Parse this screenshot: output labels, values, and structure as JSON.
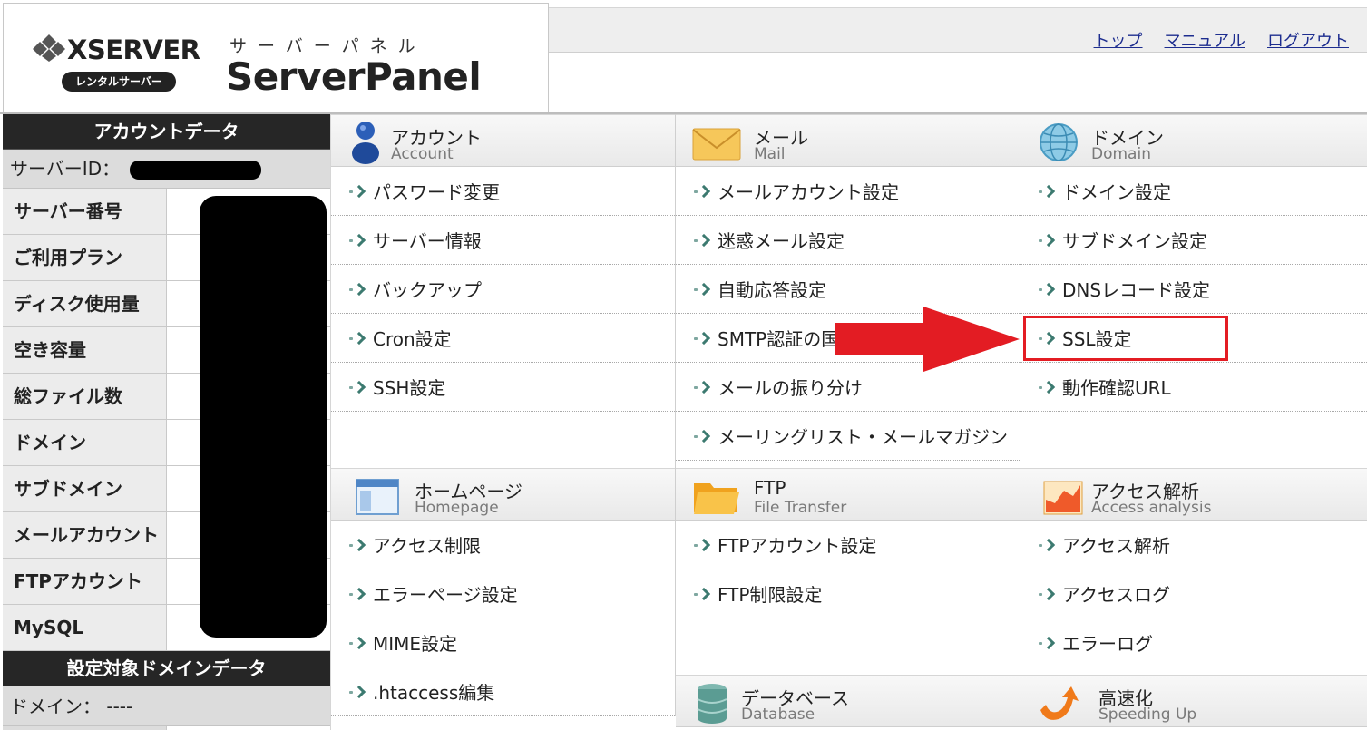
{
  "brand": {
    "xserver": "XSERVER",
    "rental": "レンタルサーバー",
    "panel_sub": "サーバーパネル",
    "panel_main": "ServerPanel"
  },
  "toplinks": [
    "トップ",
    "マニュアル",
    "ログアウト"
  ],
  "account_panel": {
    "title": "アカウントデータ",
    "server_id_label": "サーバーID：",
    "rows": [
      "サーバー番号",
      "ご利用プラン",
      "ディスク使用量",
      "空き容量",
      "総ファイル数",
      "ドメイン",
      "サブドメイン",
      "メールアカウント",
      "FTPアカウント",
      "MySQL"
    ]
  },
  "domain_panel": {
    "title": "設定対象ドメインデータ",
    "domain_label": "ドメイン：",
    "domain_value": "----"
  },
  "sections": {
    "account": {
      "jp": "アカウント",
      "en": "Account",
      "items": [
        "パスワード変更",
        "サーバー情報",
        "バックアップ",
        "Cron設定",
        "SSH設定"
      ]
    },
    "mail": {
      "jp": "メール",
      "en": "Mail",
      "items": [
        "メールアカウント設定",
        "迷惑メール設定",
        "自動応答設定",
        "SMTP認証の国",
        "メールの振り分け",
        "メーリングリスト・メールマガジン"
      ]
    },
    "domain": {
      "jp": "ドメイン",
      "en": "Domain",
      "items": [
        "ドメイン設定",
        "サブドメイン設定",
        "DNSレコード設定",
        "SSL設定",
        "動作確認URL"
      ]
    },
    "homepage": {
      "jp": "ホームページ",
      "en": "Homepage",
      "items": [
        "アクセス制限",
        "エラーページ設定",
        "MIME設定",
        ".htaccess編集"
      ]
    },
    "ftp": {
      "jp": "FTP",
      "en": "File Transfer",
      "items": [
        "FTPアカウント設定",
        "FTP制限設定"
      ]
    },
    "access": {
      "jp": "アクセス解析",
      "en": "Access analysis",
      "items": [
        "アクセス解析",
        "アクセスログ",
        "エラーログ"
      ]
    },
    "database": {
      "jp": "データベース",
      "en": "Database"
    },
    "speed": {
      "jp": "高速化",
      "en": "Speeding Up"
    }
  },
  "colors": {
    "highlight": "#e31c23",
    "link": "#1d2d8f",
    "dark_header": "#262626"
  }
}
